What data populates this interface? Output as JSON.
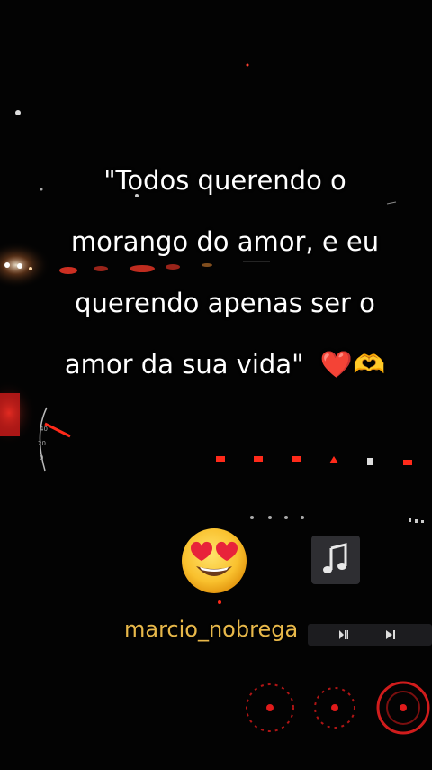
{
  "quote": {
    "lines": [
      "\"Todos querendo o",
      "morango do amor, e eu",
      "querendo apenas ser o",
      "amor da sua vida\""
    ],
    "emojis": "❤️🫶"
  },
  "username": "marcio_nobrega",
  "icons": {
    "heart_eyes": "heart-eyes-emoji",
    "music_note": "music-note-icon",
    "play_pause": "play-pause-icon",
    "skip_next": "skip-next-icon"
  },
  "colors": {
    "text": "#ffffff",
    "username": "#e8b84a",
    "dash_red": "#e01b1b"
  }
}
